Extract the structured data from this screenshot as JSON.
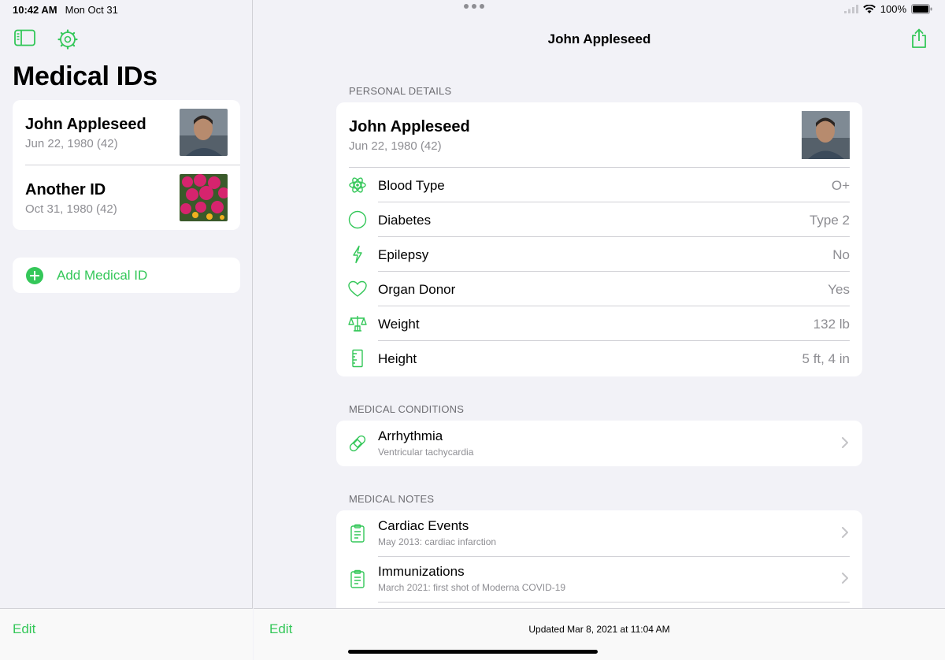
{
  "status_bar": {
    "time": "10:42 AM",
    "date": "Mon Oct 31",
    "battery": "100%"
  },
  "sidebar": {
    "title": "Medical IDs",
    "ids": [
      {
        "name": "John Appleseed",
        "birth": "Jun 22, 1980 (42)"
      },
      {
        "name": "Another ID",
        "birth": "Oct 31, 1980 (42)"
      }
    ],
    "add_label": "Add Medical ID",
    "edit_label": "Edit"
  },
  "detail": {
    "nav_title": "John Appleseed",
    "personal_header": "PERSONAL DETAILS",
    "person_name": "John Appleseed",
    "person_birth": "Jun 22, 1980 (42)",
    "fields": [
      {
        "label": "Blood Type",
        "value": "O+",
        "icon": "atom-icon"
      },
      {
        "label": "Diabetes",
        "value": "Type 2",
        "icon": "circle-icon"
      },
      {
        "label": "Epilepsy",
        "value": "No",
        "icon": "bolt-icon"
      },
      {
        "label": "Organ Donor",
        "value": "Yes",
        "icon": "heart-icon"
      },
      {
        "label": "Weight",
        "value": "132 lb",
        "icon": "scale-icon"
      },
      {
        "label": "Height",
        "value": "5 ft, 4 in",
        "icon": "ruler-icon"
      }
    ],
    "conditions_header": "MEDICAL CONDITIONS",
    "conditions": [
      {
        "title": "Arrhythmia",
        "detail": "Ventricular tachycardia",
        "icon": "bandage-icon"
      }
    ],
    "notes_header": "MEDICAL NOTES",
    "notes": [
      {
        "title": "Cardiac Events",
        "detail": "May 2013: cardiac infarction",
        "icon": "clipboard-icon"
      },
      {
        "title": "Immunizations",
        "detail": "March 2021: first shot of Moderna COVID-19",
        "icon": "clipboard-icon"
      }
    ],
    "edit_label": "Edit",
    "updated": "Updated Mar 8, 2021 at 11:04 AM"
  },
  "colors": {
    "accent": "#34c759",
    "background": "#f2f2f7",
    "secondary_text": "#8e8e93"
  }
}
